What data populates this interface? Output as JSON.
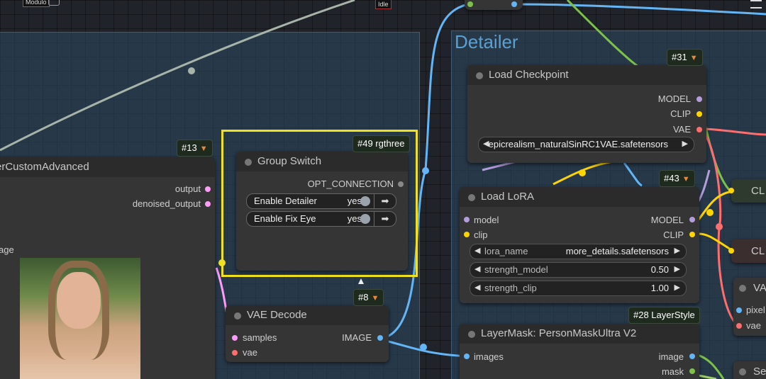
{
  "status": {
    "idle": "Idle",
    "top_left_tag": "Modulo"
  },
  "groups": {
    "left": {
      "title": "erCustomAdvanced"
    },
    "detailer": {
      "title": "Detailer"
    }
  },
  "nodes": {
    "sampler": {
      "badge": "#13",
      "title": "erCustomAdvanced",
      "outputs": [
        "output",
        "denoised_output"
      ],
      "input_partial": "age"
    },
    "group_switch": {
      "badge": "#49 rgthree",
      "title": "Group Switch",
      "output": "OPT_CONNECTION",
      "toggles": [
        {
          "label": "Enable Detailer",
          "value": "yes"
        },
        {
          "label": "Enable Fix Eye",
          "value": "yes"
        }
      ]
    },
    "vae_decode": {
      "badge": "#8",
      "title": "VAE Decode",
      "inputs": [
        "samples",
        "vae"
      ],
      "output": "IMAGE"
    },
    "load_checkpoint": {
      "badge": "#31",
      "title": "Load Checkpoint",
      "outputs": [
        "MODEL",
        "CLIP",
        "VAE"
      ],
      "ckpt_value": "epicrealism_naturalSinRC1VAE.safetensors"
    },
    "load_lora": {
      "badge": "#43",
      "title": "Load LoRA",
      "inputs": [
        "model",
        "clip"
      ],
      "outputs": [
        "MODEL",
        "CLIP"
      ],
      "widgets": [
        {
          "label": "lora_name",
          "value": "more_details.safetensors"
        },
        {
          "label": "strength_model",
          "value": "0.50"
        },
        {
          "label": "strength_clip",
          "value": "1.00"
        }
      ]
    },
    "layermask": {
      "badge": "#28 LayerStyle",
      "title": "LayerMask: PersonMaskUltra V2",
      "inputs": [
        "images"
      ],
      "outputs": [
        "image",
        "mask"
      ]
    },
    "right_partial": {
      "cl1": "CL",
      "cl2": "CL",
      "va": "VA",
      "pixel": "pixel",
      "vae": "vae",
      "se": "Se"
    }
  },
  "colors": {
    "model_pin": "#b39ddb",
    "clip_pin": "#ffd500",
    "vae_pin": "#ff6e6e",
    "image_pin": "#64b5f6",
    "latent_pin": "#ff9cf9",
    "highlight": "#f0e020"
  }
}
